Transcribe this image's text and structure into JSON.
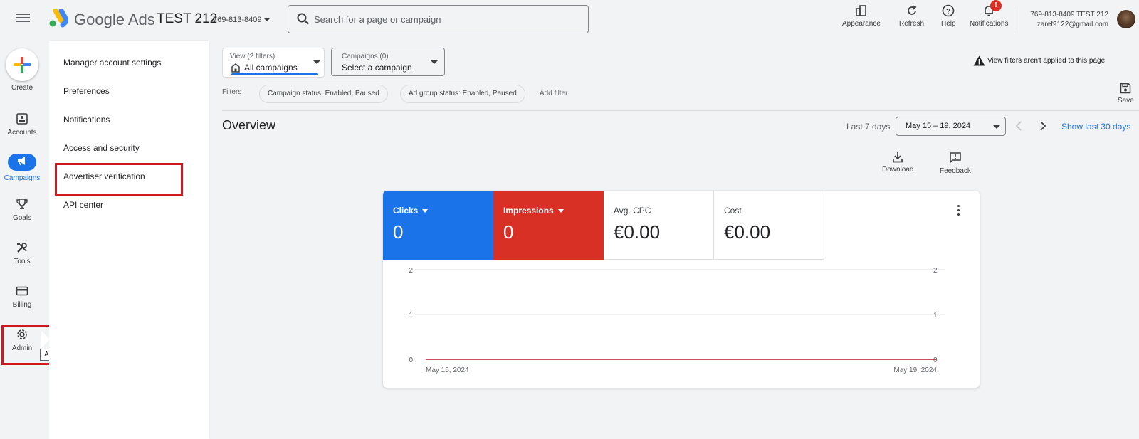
{
  "topbar": {
    "brand": "Google Ads",
    "account_name": "TEST 212",
    "account_id": "769-813-8409",
    "search_placeholder": "Search for a page or campaign",
    "buttons": {
      "appearance": "Appearance",
      "refresh": "Refresh",
      "help": "Help",
      "notifications": "Notifications"
    },
    "notification_badge": "!",
    "user": {
      "line1": "769-813-8409 TEST 212",
      "email": "zaref9122@gmail.com"
    }
  },
  "rail": {
    "create": "Create",
    "accounts": "Accounts",
    "campaigns": "Campaigns",
    "goals": "Goals",
    "tools": "Tools",
    "billing": "Billing",
    "admin": "Admin",
    "admin_tooltip": "Admin"
  },
  "submenu": {
    "items": [
      "Manager account settings",
      "Preferences",
      "Notifications",
      "Access and security",
      "Advertiser verification",
      "API center"
    ]
  },
  "main": {
    "view_selector": {
      "label": "View (2 filters)",
      "value": "All campaigns"
    },
    "campaign_selector": {
      "label": "Campaigns (0)",
      "value": "Select a campaign"
    },
    "warning": "View filters aren't applied to this page",
    "filters_label": "Filters",
    "filter_chips": [
      "Campaign status: Enabled, Paused",
      "Ad group status: Enabled, Paused"
    ],
    "add_filter": "Add filter",
    "save": "Save",
    "overview_title": "Overview",
    "date_label": "Last 7 days",
    "date_range": "May 15 – 19, 2024",
    "show_last_30": "Show last 30 days",
    "download": "Download",
    "feedback": "Feedback"
  },
  "metrics": [
    {
      "label": "Clicks",
      "value": "0",
      "color": "#1a73e8"
    },
    {
      "label": "Impressions",
      "value": "0",
      "color": "#d93025"
    },
    {
      "label": "Avg. CPC",
      "value": "€0.00"
    },
    {
      "label": "Cost",
      "value": "€0.00"
    }
  ],
  "chart_data": {
    "type": "line",
    "x": [
      "May 15, 2024",
      "May 19, 2024"
    ],
    "series": [
      {
        "values": [
          0,
          0
        ],
        "color": "#1a73e8"
      },
      {
        "values": [
          0,
          0
        ],
        "color": "#d93025"
      }
    ],
    "y_ticks": [
      0,
      1,
      2
    ],
    "ylim": [
      0,
      2
    ],
    "grid": true
  }
}
